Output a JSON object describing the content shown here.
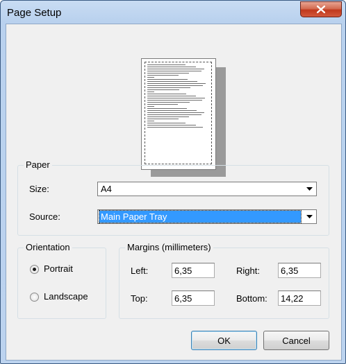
{
  "window": {
    "title": "Page Setup",
    "close_icon": "close-icon"
  },
  "paper": {
    "group_label": "Paper",
    "size_label": "Size:",
    "size_value": "A4",
    "source_label": "Source:",
    "source_value": "Main Paper Tray"
  },
  "orientation": {
    "group_label": "Orientation",
    "portrait_label": "Portrait",
    "landscape_label": "Landscape",
    "selected": "Portrait"
  },
  "margins": {
    "group_label": "Margins (millimeters)",
    "left_label": "Left:",
    "left_value": "6,35",
    "right_label": "Right:",
    "right_value": "6,35",
    "top_label": "Top:",
    "top_value": "6,35",
    "bottom_label": "Bottom:",
    "bottom_value": "14,22"
  },
  "buttons": {
    "ok": "OK",
    "cancel": "Cancel"
  },
  "colors": {
    "title_bar": "#b9d1ee",
    "close_button": "#c7432a",
    "selection": "#3399ff",
    "dialog_bg": "#f0f0f0"
  }
}
